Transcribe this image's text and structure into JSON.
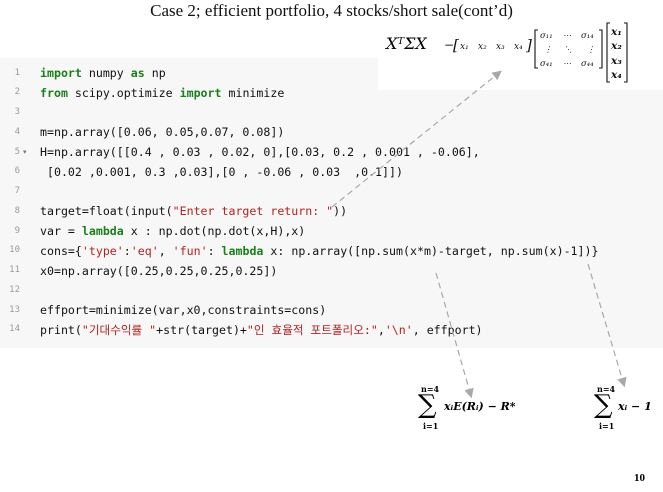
{
  "slide": {
    "title": "Case 2; efficient portfolio, 4 stocks/short sale(cont’d)",
    "page_number": "10"
  },
  "code": {
    "lines": [
      {
        "n": "1",
        "text": "import numpy as np"
      },
      {
        "n": "2",
        "text": "from scipy.optimize import minimize"
      },
      {
        "n": "3",
        "text": ""
      },
      {
        "n": "4",
        "text": "m=np.array([0.06, 0.05,0.07, 0.08])"
      },
      {
        "n": "5",
        "text": "H=np.array([[0.4 , 0.03 , 0.02, 0],[0.03, 0.2 , 0.001 , -0.06],"
      },
      {
        "n": "6",
        "text": " [0.02 ,0.001, 0.3 ,0.03],[0 , -0.06 , 0.03  ,0.1]])"
      },
      {
        "n": "7",
        "text": ""
      },
      {
        "n": "8",
        "text": "target=float(input(\"Enter target return: \"))"
      },
      {
        "n": "9",
        "text": "var = lambda x : np.dot(np.dot(x,H),x)"
      },
      {
        "n": "10",
        "text": "cons={'type':'eq', 'fun': lambda x: np.array([np.sum(x*m)-target, np.sum(x)-1])}"
      },
      {
        "n": "11",
        "text": "x0=np.array([0.25,0.25,0.25,0.25])"
      },
      {
        "n": "12",
        "text": ""
      },
      {
        "n": "13",
        "text": "effport=minimize(var,x0,constraints=cons)"
      },
      {
        "n": "14",
        "text": "print(\"기대수익률 \"+str(target)+\"인 효율적 포트폴리오:\",'\\n', effport)"
      }
    ]
  },
  "annotations": {
    "quadratic_form": "XᵀΣX",
    "eq1": "Σ xᵢE(Rᵢ) − R*",
    "eq2": "Σ xᵢ − 1",
    "sum_upper": "n=4",
    "sum_lower": "i=1"
  },
  "colors": {
    "keyword": "#1a7f1a",
    "string": "#b22222",
    "line_number": "#9a9a9a",
    "code_bg": "#f7f7f7"
  }
}
